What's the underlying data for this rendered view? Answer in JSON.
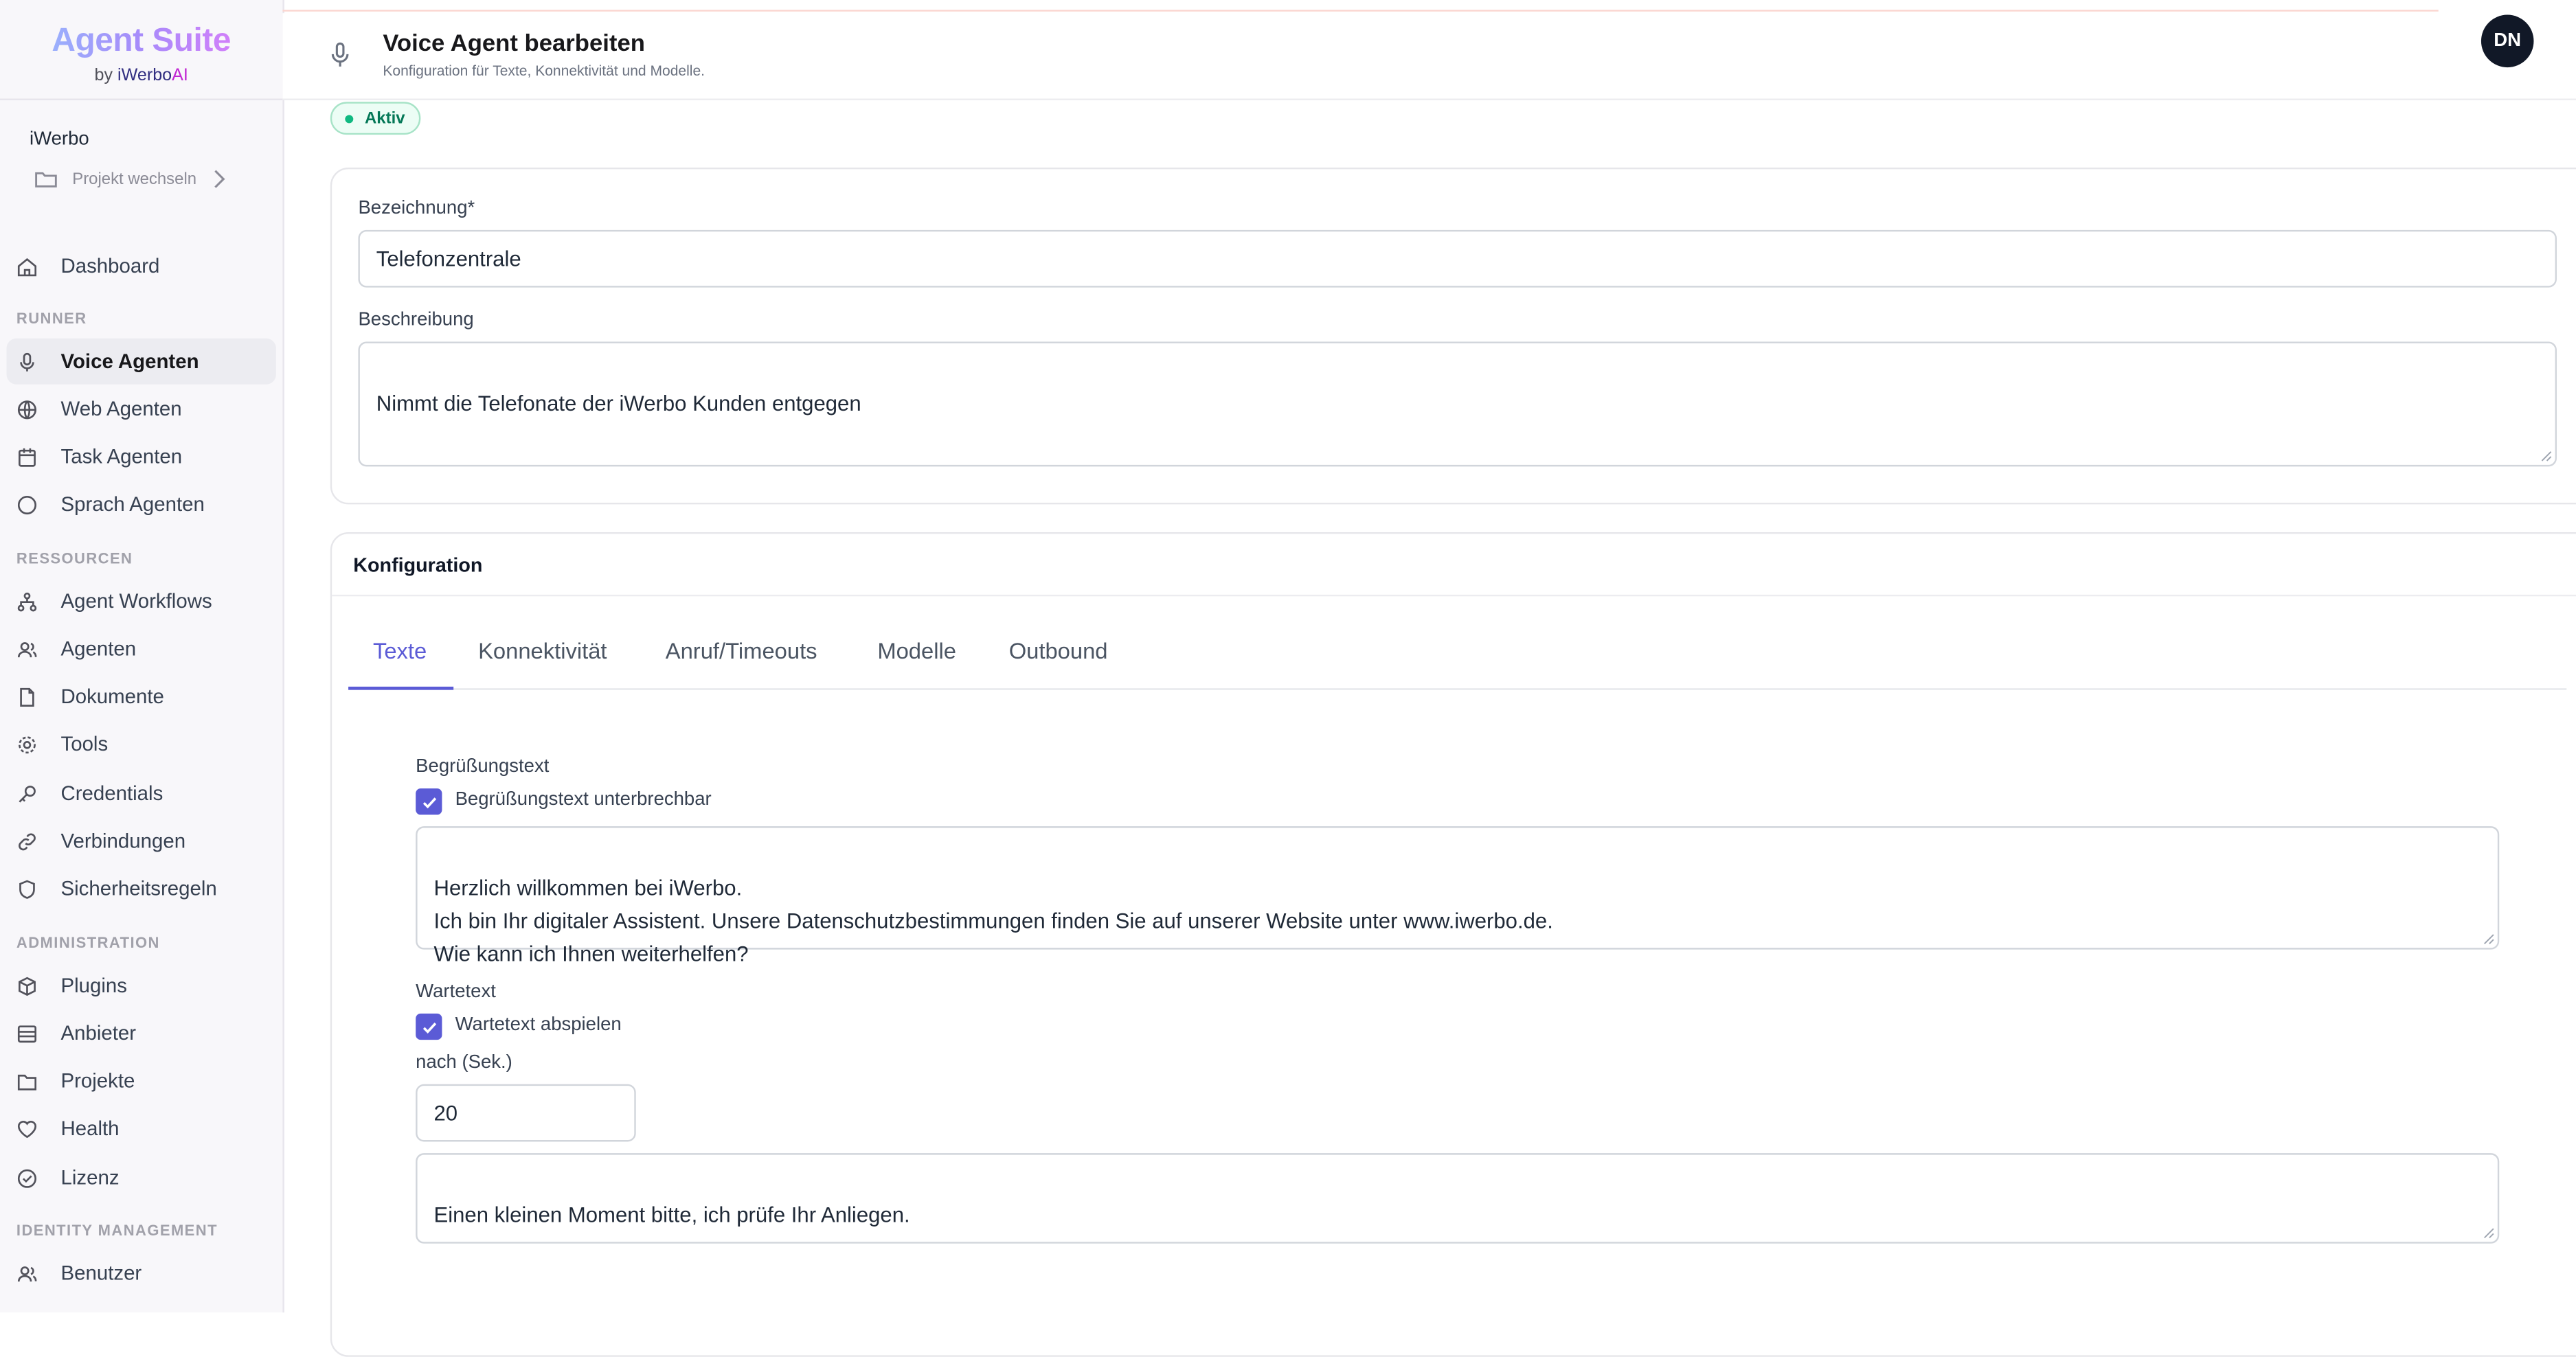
{
  "brand": {
    "title": "Agent Suite",
    "by": "by",
    "company_a": "iWerbo",
    "company_b": "AI"
  },
  "org": {
    "name": "iWerbo",
    "switch_project": "Projekt wechseln"
  },
  "nav": {
    "dashboard": "Dashboard",
    "sections": {
      "runner": "RUNNER",
      "resources": "RESSOURCEN",
      "administration": "ADMINISTRATION",
      "identity": "IDENTITY MANAGEMENT"
    },
    "runner": [
      "Voice Agenten",
      "Web Agenten",
      "Task Agenten",
      "Sprach Agenten"
    ],
    "resources": [
      "Agent Workflows",
      "Agenten",
      "Dokumente",
      "Tools",
      "Credentials",
      "Verbindungen",
      "Sicherheitsregeln"
    ],
    "administration": [
      "Plugins",
      "Anbieter",
      "Projekte",
      "Health",
      "Lizenz"
    ],
    "identity": [
      "Benutzer"
    ],
    "active": "Voice Agenten"
  },
  "header": {
    "title": "Voice Agent bearbeiten",
    "subtitle": "Konfiguration für Texte, Konnektivität und Modelle.",
    "avatar": "DN"
  },
  "status": {
    "label": "Aktiv",
    "color": "#10b981"
  },
  "form": {
    "name_label": "Bezeichnung*",
    "name_value": "Telefonzentrale",
    "desc_label": "Beschreibung",
    "desc_value": "Nimmt die Telefonate der iWerbo Kunden entgegen"
  },
  "config": {
    "title": "Konfiguration",
    "tabs": [
      "Texte",
      "Konnektivität",
      "Anruf/Timeouts",
      "Modelle",
      "Outbound"
    ],
    "active_tab": "Texte",
    "greeting": {
      "label": "Begrüßungstext",
      "interruptible_label": "Begrüßungstext unterbrechbar",
      "interruptible": true,
      "text": "Herzlich willkommen bei iWerbo.\nIch bin Ihr digitaler Assistent. Unsere Datenschutzbestimmungen finden Sie auf unserer Website unter www.iwerbo.de.\nWie kann ich Ihnen weiterhelfen?"
    },
    "wait": {
      "label": "Wartetext",
      "play_label": "Wartetext abspielen",
      "play": true,
      "after_label": "nach (Sek.)",
      "after_value": "20",
      "text": "Einen kleinen Moment bitte, ich prüfe Ihr Anliegen."
    }
  },
  "colors": {
    "accent": "#5b5bd6",
    "sidebar_bg": "#f8f7fa",
    "success": "#10b981"
  }
}
